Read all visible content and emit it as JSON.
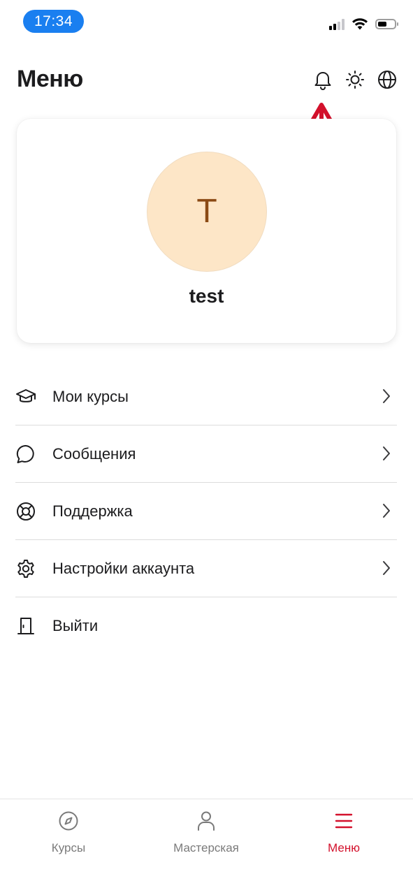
{
  "status_bar": {
    "time": "17:34"
  },
  "header": {
    "title": "Меню",
    "icons": [
      "bell-icon",
      "sun-icon",
      "globe-icon"
    ]
  },
  "annotation": {
    "color": "#d3112c"
  },
  "profile": {
    "initial": "T",
    "name": "test",
    "avatar_bg": "#fde6c7",
    "avatar_fg": "#8b4a14"
  },
  "menu": {
    "items": [
      {
        "label": "Мои курсы",
        "icon": "graduation-cap-icon"
      },
      {
        "label": "Сообщения",
        "icon": "chat-bubble-icon"
      },
      {
        "label": "Поддержка",
        "icon": "lifebuoy-icon"
      },
      {
        "label": "Настройки аккаунта",
        "icon": "gear-icon"
      },
      {
        "label": "Выйти",
        "icon": "door-icon"
      }
    ]
  },
  "tab_bar": {
    "tabs": [
      {
        "label": "Курсы",
        "icon": "compass-icon",
        "active": false
      },
      {
        "label": "Мастерская",
        "icon": "user-icon",
        "active": false
      },
      {
        "label": "Меню",
        "icon": "hamburger-icon",
        "active": true
      }
    ],
    "active_color": "#d3112c",
    "inactive_color": "#7a7a7a"
  }
}
